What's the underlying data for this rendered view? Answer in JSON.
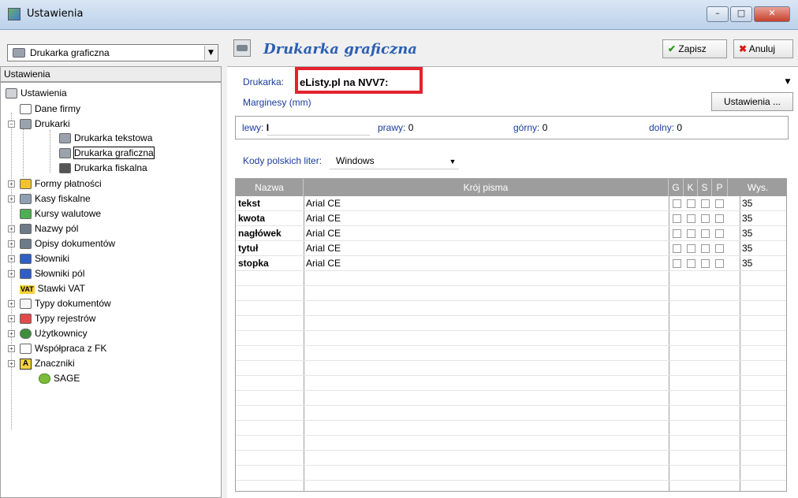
{
  "window": {
    "title": "Ustawienia",
    "min_label": "–",
    "max_label": "□",
    "close_label": "✕"
  },
  "left": {
    "combo_value": "Drukarka graficzna",
    "panel_title": "Ustawienia",
    "tree": {
      "root": "Ustawienia",
      "items": [
        "Dane firmy",
        "Drukarki",
        "Drukarka tekstowa",
        "Drukarka graficzna",
        "Drukarka fiskalna",
        "Formy płatności",
        "Kasy fiskalne",
        "Kursy walutowe",
        "Nazwy pól",
        "Opisy dokumentów",
        "Słowniki",
        "Słowniki pól",
        "Stawki VAT",
        "Typy dokumentów",
        "Typy rejestrów",
        "Użytkownicy",
        "Współpraca z FK",
        "Znaczniki",
        "SAGE"
      ],
      "vat_badge": "VAT",
      "znaczniki_badge": "A"
    }
  },
  "right": {
    "heading": "Drukarka graficzna",
    "save_label": "Zapisz",
    "cancel_label": "Anuluj",
    "printer_label": "Drukarka:",
    "printer_value": "eListy.pl na NVV7:",
    "margins_label": "Marginesy (mm)",
    "settings_button": "Ustawienia ...",
    "margins": {
      "left_label": "lewy:",
      "left_value": "",
      "right_label": "prawy:",
      "right_value": "0",
      "top_label": "górny:",
      "top_value": "0",
      "bottom_label": "dolny:",
      "bottom_value": "0"
    },
    "encoding_label": "Kody polskich liter:",
    "encoding_value": "Windows",
    "grid": {
      "columns": [
        "Nazwa",
        "Krój pisma",
        "G",
        "K",
        "S",
        "P",
        "Wys."
      ],
      "rows": [
        {
          "name": "tekst",
          "font": "Arial CE",
          "height": "35"
        },
        {
          "name": "kwota",
          "font": "Arial CE",
          "height": "35"
        },
        {
          "name": "nagłówek",
          "font": "Arial CE",
          "height": "35"
        },
        {
          "name": "tytuł",
          "font": "Arial CE",
          "height": "35"
        },
        {
          "name": "stopka",
          "font": "Arial CE",
          "height": "35"
        }
      ]
    }
  },
  "colors": {
    "heading": "#2b5fb3",
    "highlight": "#e3232e",
    "grid_header": "#9d9d9d"
  }
}
